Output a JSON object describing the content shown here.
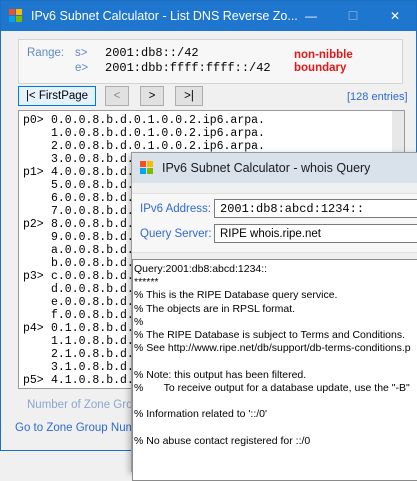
{
  "main_window": {
    "title": "IPv6 Subnet Calculator - List DNS Reverse Zo...",
    "minimize": "—",
    "maximize": "☐",
    "close": "✕"
  },
  "range": {
    "label": "Range:",
    "start_prefix": "s>",
    "start_value": "2001:db8::/42",
    "end_prefix": "e>",
    "end_value": "2001:dbb:ffff:ffff::/42",
    "warning_line1": "non-nibble",
    "warning_line2": "boundary"
  },
  "nav": {
    "first_page": "|< FirstPage",
    "prev": "<",
    "next": ">",
    "last": ">|",
    "entries": "[128 entries]"
  },
  "list_rows": [
    {
      "prefix": "p0>",
      "text": "0.0.0.8.b.d.0.1.0.0.2.ip6.arpa."
    },
    {
      "prefix": "",
      "text": "1.0.0.8.b.d.0.1.0.0.2.ip6.arpa."
    },
    {
      "prefix": "",
      "text": "2.0.0.8.b.d.0.1.0.0.2.ip6.arpa."
    },
    {
      "prefix": "",
      "text": "3.0.0.8.b.d."
    },
    {
      "prefix": "p1>",
      "text": "4.0.0.8.b.d."
    },
    {
      "prefix": "",
      "text": "5.0.0.8.b.d."
    },
    {
      "prefix": "",
      "text": "6.0.0.8.b.d."
    },
    {
      "prefix": "",
      "text": "7.0.0.8.b.d."
    },
    {
      "prefix": "p2>",
      "text": "8.0.0.8.b.d."
    },
    {
      "prefix": "",
      "text": "9.0.0.8.b.d."
    },
    {
      "prefix": "",
      "text": "a.0.0.8.b.d."
    },
    {
      "prefix": "",
      "text": "b.0.0.8.b.d."
    },
    {
      "prefix": "p3>",
      "text": "c.0.0.8.b.d."
    },
    {
      "prefix": "",
      "text": "d.0.0.8.b.d."
    },
    {
      "prefix": "",
      "text": "e.0.0.8.b.d."
    },
    {
      "prefix": "",
      "text": "f.0.0.8.b.d."
    },
    {
      "prefix": "p4>",
      "text": "0.1.0.8.b.d."
    },
    {
      "prefix": "",
      "text": "1.1.0.8.b.d."
    },
    {
      "prefix": "",
      "text": "2.1.0.8.b.d."
    },
    {
      "prefix": "",
      "text": "3.1.0.8.b.d."
    },
    {
      "prefix": "p5>",
      "text": "4.1.0.8.b.d."
    }
  ],
  "footer": {
    "zone_group_count_label": "Number of Zone Group",
    "goto_zone_group_label": "Go to Zone Group Num"
  },
  "whois_window": {
    "title": "IPv6 Subnet Calculator - whois Query",
    "address_label": "IPv6 Address:",
    "address_value": "2001:db8:abcd:1234::",
    "server_label": "Query Server:",
    "server_value": "RIPE whois.ripe.net",
    "output_lines": [
      "Query:2001:db8:abcd:1234::",
      "******",
      "% This is the RIPE Database query service.",
      "% The objects are in RPSL format.",
      "%",
      "% The RIPE Database is subject to Terms and Conditions.",
      "% See http://www.ripe.net/db/support/db-terms-conditions.p",
      "",
      "% Note: this output has been filtered.",
      "%       To receive output for a database update, use the \"-B\"",
      "",
      "% Information related to '::/0'",
      "",
      "% No abuse contact registered for ::/0"
    ]
  },
  "colors": {
    "main_titlebar": "#1e76cf",
    "label_blue": "#2f6ad0",
    "warning_red": "#e01818"
  }
}
